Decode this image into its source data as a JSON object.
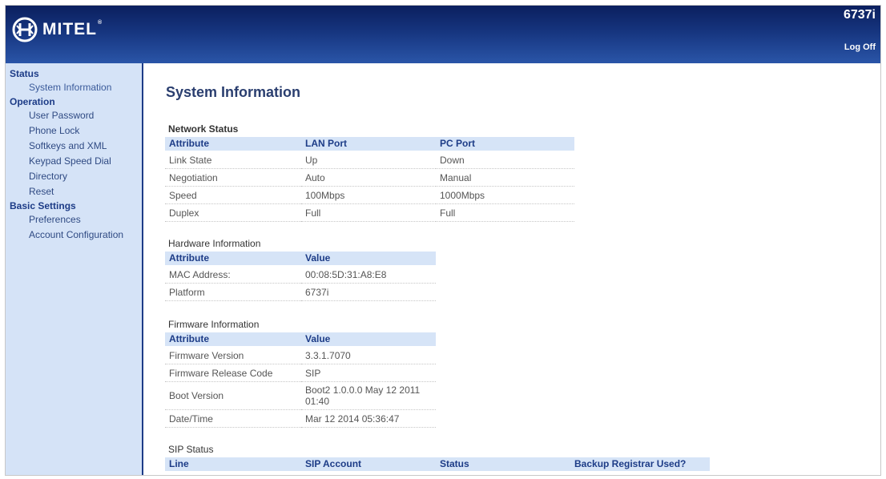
{
  "header": {
    "brand": "MITEL",
    "brand_mark": "®",
    "model": "6737i",
    "logoff_label": "Log Off"
  },
  "sidebar": {
    "sections": [
      {
        "label": "Status",
        "items": [
          "System Information"
        ]
      },
      {
        "label": "Operation",
        "items": [
          "User Password",
          "Phone Lock",
          "Softkeys and XML",
          "Keypad Speed Dial",
          "Directory",
          "Reset"
        ]
      },
      {
        "label": "Basic Settings",
        "items": [
          "Preferences",
          "Account Configuration"
        ]
      }
    ]
  },
  "page": {
    "title": "System Information"
  },
  "network": {
    "title": "Network Status",
    "headers": [
      "Attribute",
      "LAN Port",
      "PC Port"
    ],
    "rows": [
      [
        "Link State",
        "Up",
        "Down"
      ],
      [
        "Negotiation",
        "Auto",
        "Manual"
      ],
      [
        "Speed",
        "100Mbps",
        "1000Mbps"
      ],
      [
        "Duplex",
        "Full",
        "Full"
      ]
    ]
  },
  "hardware": {
    "title": "Hardware Information",
    "headers": [
      "Attribute",
      "Value"
    ],
    "rows": [
      [
        "MAC Address:",
        "00:08:5D:31:A8:E8"
      ],
      [
        "Platform",
        "6737i"
      ]
    ]
  },
  "firmware": {
    "title": "Firmware Information",
    "headers": [
      "Attribute",
      "Value"
    ],
    "rows": [
      [
        "Firmware Version",
        "3.3.1.7070"
      ],
      [
        "Firmware Release Code",
        "SIP"
      ],
      [
        "Boot Version",
        "Boot2 1.0.0.0 May 12 2011 01:40"
      ],
      [
        "Date/Time",
        "Mar 12 2014 05:36:47"
      ]
    ]
  },
  "sip": {
    "title": "SIP Status",
    "headers": [
      "Line",
      "SIP Account",
      "Status",
      "Backup Registrar Used?"
    ]
  }
}
